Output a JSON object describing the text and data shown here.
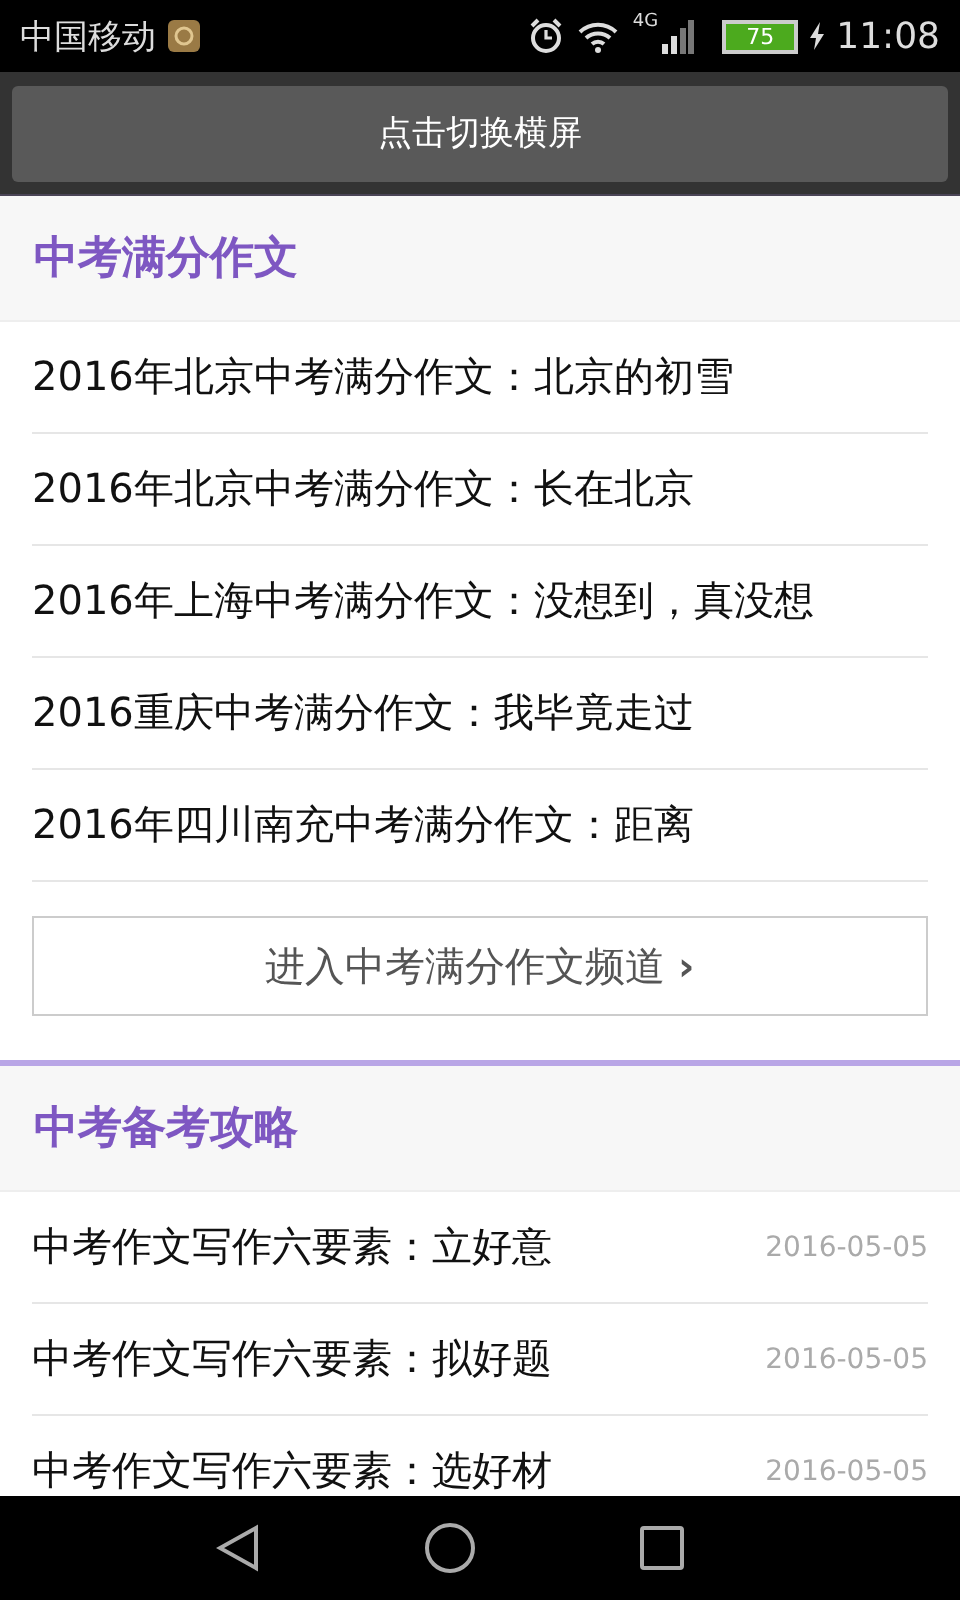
{
  "status_bar": {
    "carrier": "中国移动",
    "network": "4G",
    "battery": "75",
    "time": "11:08"
  },
  "rotate_button": {
    "label": "点击切换横屏"
  },
  "sections": [
    {
      "title": "中考满分作文",
      "items": [
        {
          "title": "2016年北京中考满分作文：北京的初雪"
        },
        {
          "title": "2016年北京中考满分作文：长在北京"
        },
        {
          "title": "2016年上海中考满分作文：没想到，真没想"
        },
        {
          "title": "2016重庆中考满分作文：我毕竟走过"
        },
        {
          "title": "2016年四川南充中考满分作文：距离"
        }
      ],
      "more_link": {
        "label": "进入中考满分作文频道",
        "arrow": "›"
      }
    },
    {
      "title": "中考备考攻略",
      "items": [
        {
          "title": "中考作文写作六要素：立好意",
          "date": "2016-05-05"
        },
        {
          "title": "中考作文写作六要素：拟好题",
          "date": "2016-05-05"
        },
        {
          "title": "中考作文写作六要素：选好材",
          "date": "2016-05-05"
        }
      ]
    }
  ]
}
